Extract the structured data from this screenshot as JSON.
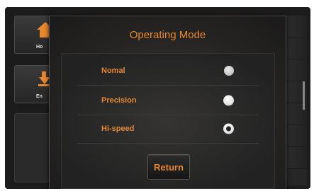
{
  "background": {
    "buttons": [
      {
        "label": "Ho",
        "icon": "home-icon"
      },
      {
        "label": "En",
        "icon": "energy-icon"
      }
    ]
  },
  "dialog": {
    "title": "Operating Mode",
    "options": [
      {
        "label": "Nomal",
        "selected": false
      },
      {
        "label": "Precision",
        "selected": false
      },
      {
        "label": "Hi-speed",
        "selected": true
      }
    ],
    "return_label": "Return"
  },
  "colors": {
    "accent": "#e8872e",
    "background": "#1c1c1c"
  }
}
